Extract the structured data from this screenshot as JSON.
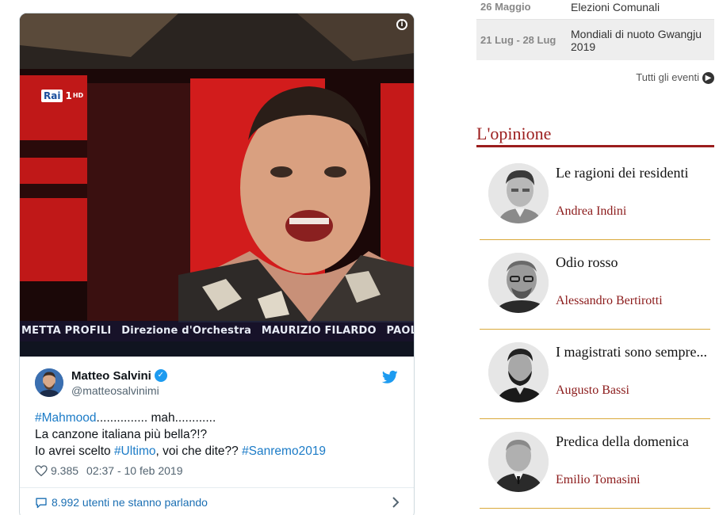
{
  "tweet": {
    "media": {
      "channel_logo": "Rai",
      "channel_number": "1",
      "channel_hd": "HD",
      "credits": [
        "METTA PROFILI",
        "Direzione d'Orchestra",
        "MAURIZIO FILARDO",
        "PAOLO G"
      ],
      "info_icon": "i"
    },
    "author": {
      "name": "Matteo Salvini",
      "handle": "@matteosalvinimi",
      "verified": true
    },
    "text": {
      "line1_hashtag": "#Mahmood",
      "line1_rest": "............... mah............",
      "line2": "La canzone italiana più bella?!?",
      "line3_pre": "Io avrei scelto ",
      "line3_hashtag1": "#Ultimo",
      "line3_mid": ", voi che dite?? ",
      "line3_hashtag2": "#Sanremo2019"
    },
    "likes": "9.385",
    "timestamp": "02:37 - 10 feb 2019",
    "footer_text": "8.992 utenti ne stanno parlando",
    "colors": {
      "link": "#1b7bc7",
      "verified": "#1d9bf0",
      "twitter_brand": "#1d9bf0"
    }
  },
  "events": {
    "rows": [
      {
        "date": "26 Maggio",
        "name": "Elezioni Comunali"
      },
      {
        "date": "21 Lug - 28 Lug",
        "name": "Mondiali di nuoto Gwangju 2019"
      }
    ],
    "all_events_label": "Tutti gli eventi"
  },
  "opinions": {
    "title": "L'opinione",
    "accent_color": "#9b1d1d",
    "items": [
      {
        "title": "Le ragioni dei residenti",
        "author": "Andrea Indini"
      },
      {
        "title": "Odio rosso",
        "author": "Alessandro Bertirotti"
      },
      {
        "title": "I magistrati sono sempre...",
        "author": "Augusto Bassi"
      },
      {
        "title": "Predica della domenica",
        "author": "Emilio Tomasini"
      }
    ]
  }
}
